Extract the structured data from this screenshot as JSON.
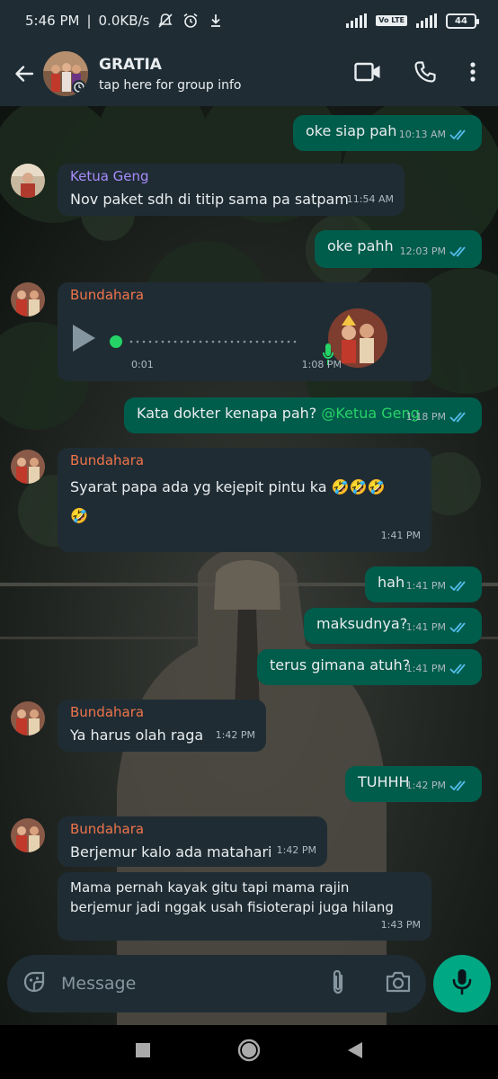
{
  "status_bar": {
    "time": "5:46 PM",
    "speed": "0.0KB/s",
    "lte_label": "Vo LTE",
    "battery": "44"
  },
  "header": {
    "title": "GRATIA",
    "subtitle": "tap here for group info",
    "icons": [
      "back-arrow-icon",
      "video-call-icon",
      "voice-call-icon",
      "more-options-icon"
    ]
  },
  "messages": [
    {
      "type": "out",
      "text": "oke siap pah",
      "time": "10:13 AM"
    },
    {
      "type": "in",
      "sender": "Ketua Geng",
      "sender_color": "#a78bfa",
      "text": "Nov paket sdh di titip sama pa satpam",
      "time": "11:54 AM"
    },
    {
      "type": "out",
      "text": "oke pahh",
      "time": "12:03 PM"
    },
    {
      "type": "voice",
      "sender": "Bundahara",
      "sender_color": "#f0744a",
      "duration": "0:01",
      "time": "1:08 PM"
    },
    {
      "type": "out",
      "text": "Kata dokter kenapa pah?",
      "mention": "@Ketua Geng",
      "time": "1:18 PM"
    },
    {
      "type": "in",
      "sender": "Bundahara",
      "sender_color": "#f0744a",
      "text": "Syarat papa ada yg kejepit pintu ka 🤣🤣🤣",
      "text2": "🤣",
      "time": "1:41 PM"
    },
    {
      "type": "out",
      "text": "hah",
      "time": "1:41 PM"
    },
    {
      "type": "out",
      "text": "maksudnya?",
      "time": "1:41 PM"
    },
    {
      "type": "out",
      "text": "terus gimana atuh?",
      "time": "1:41 PM"
    },
    {
      "type": "in",
      "sender": "Bundahara",
      "sender_color": "#f0744a",
      "text": "Ya harus olah raga",
      "time": "1:42 PM"
    },
    {
      "type": "out",
      "text": "TUHHH",
      "time": "1:42 PM"
    },
    {
      "type": "in",
      "sender": "Bundahara",
      "sender_color": "#f0744a",
      "text": "Berjemur kalo ada matahari",
      "time": "1:42 PM"
    },
    {
      "type": "in",
      "text": "Mama pernah kayak gitu tapi mama rajin",
      "text2": "berjemur jadi nggak usah fisioterapi juga hilang",
      "time": "1:43 PM"
    }
  ],
  "input": {
    "placeholder": "Message",
    "icons": [
      "sticker-icon",
      "attach-icon",
      "camera-icon",
      "mic-icon"
    ]
  },
  "colors": {
    "outgoing_bubble": "#005c4b",
    "incoming_bubble": "#1f2c34",
    "accent_green": "#00a884",
    "read_ticks": "#53bdeb"
  }
}
